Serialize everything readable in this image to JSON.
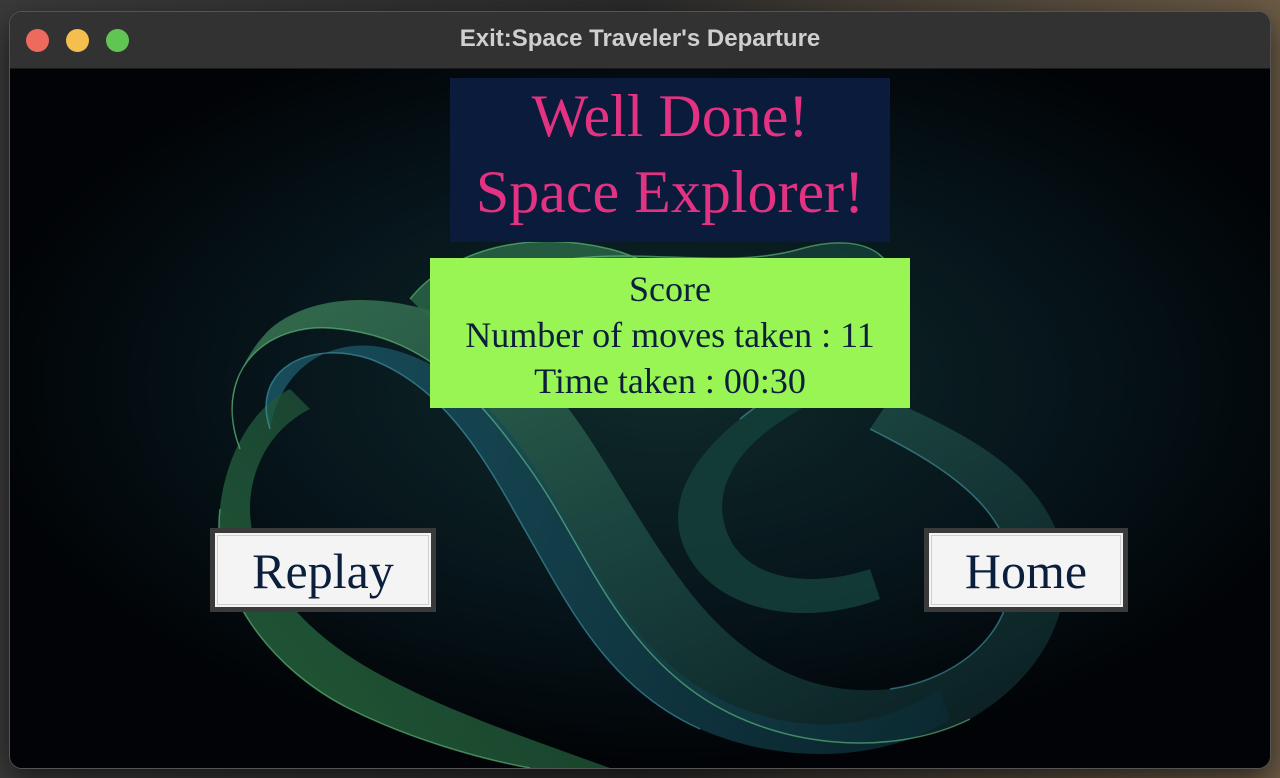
{
  "window": {
    "title": "Exit:Space Traveler's Departure"
  },
  "congrats": {
    "line1": "Well Done!",
    "line2": "Space Explorer!"
  },
  "score": {
    "heading": "Score",
    "moves_line": "Number of moves taken : 11",
    "time_line": "Time taken : 00:30",
    "moves": 11,
    "time": "00:30"
  },
  "buttons": {
    "replay_label": "Replay",
    "home_label": "Home"
  },
  "colors": {
    "title_bg": "#0a1b3c",
    "title_text": "#e23281",
    "score_bg": "#98f553",
    "score_text": "#0b1e3c",
    "button_bg": "#f4f4f4"
  }
}
